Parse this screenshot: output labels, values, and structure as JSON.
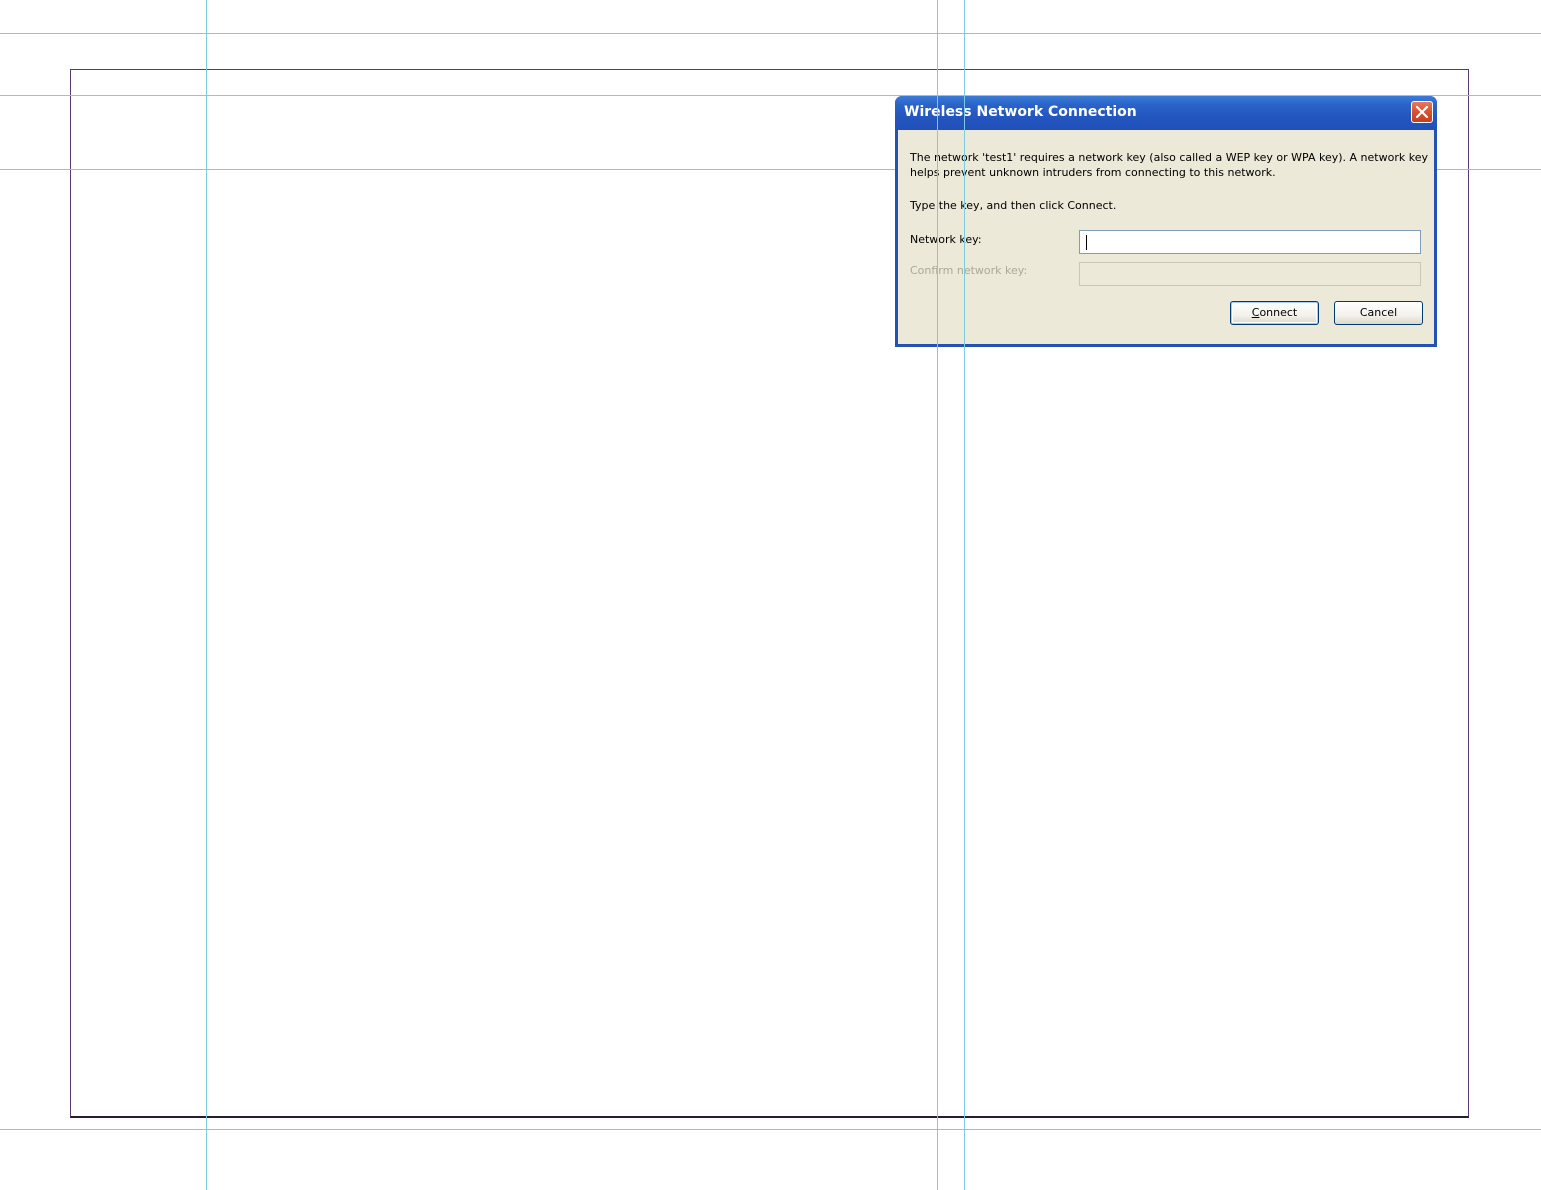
{
  "dialog": {
    "title": "Wireless Network Connection",
    "close_icon": "close-icon",
    "message": "The network 'test1' requires a network key (also called a WEP key or WPA key). A network key helps prevent unknown intruders from connecting to this network.",
    "instruction": "Type the key, and then click Connect.",
    "network_key_label": "Network key:",
    "network_key_value": "",
    "confirm_key_label": "Confirm network key:",
    "confirm_key_value": "",
    "connect_button_first": "C",
    "connect_button_rest": "onnect",
    "cancel_button": "Cancel"
  },
  "colors": {
    "titlebar": "#2456c0",
    "dialog_bg": "#ece9d8",
    "guide": "#7ecbe0",
    "page_border": "#5a3a6e",
    "close_button": "#d8502e"
  }
}
